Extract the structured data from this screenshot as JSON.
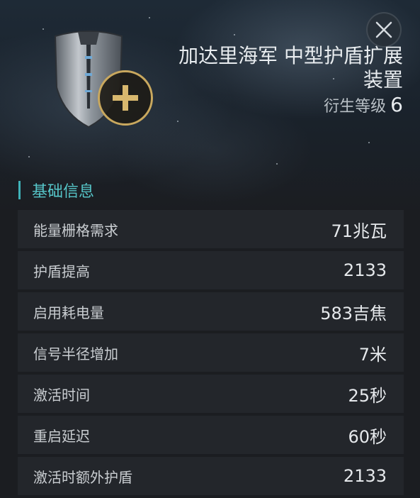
{
  "item": {
    "title": "加达里海军 中型护盾扩展装置",
    "meta_label": "衍生等级",
    "meta_level": "6"
  },
  "icons": {
    "close": "close-icon",
    "shield": "shield-icon",
    "plus": "plus-icon"
  },
  "colors": {
    "accent": "#56c5c8",
    "badge_gold": "#c9a85e"
  },
  "section": {
    "title": "基础信息"
  },
  "attributes": [
    {
      "label": "能量栅格需求",
      "value": "71兆瓦"
    },
    {
      "label": "护盾提高",
      "value": "2133"
    },
    {
      "label": "启用耗电量",
      "value": "583吉焦"
    },
    {
      "label": "信号半径增加",
      "value": "7米"
    },
    {
      "label": "激活时间",
      "value": "25秒"
    },
    {
      "label": "重启延迟",
      "value": "60秒"
    },
    {
      "label": "激活时额外护盾",
      "value": "2133"
    }
  ]
}
